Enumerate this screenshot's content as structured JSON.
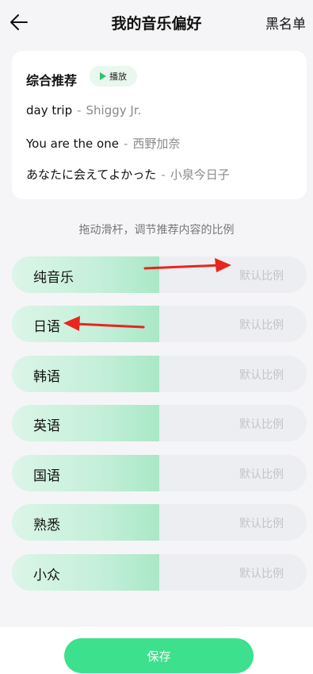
{
  "header": {
    "title": "我的音乐偏好",
    "blacklist_label": "黑名单",
    "back_icon": "arrow-left-icon"
  },
  "recommend": {
    "title": "综合推荐",
    "play_label": "播放",
    "songs": [
      {
        "title": "day trip",
        "separator": "-",
        "artist": "Shiggy Jr."
      },
      {
        "title": "You are the one",
        "separator": "-",
        "artist": "西野加奈"
      },
      {
        "title": "あなたに会えてよかった",
        "separator": "-",
        "artist": "小泉今日子"
      }
    ]
  },
  "hint": "拖动滑杆，调节推荐内容的比例",
  "sliders": [
    {
      "label": "纯音乐",
      "value_text": "默认比例",
      "level": 0.5
    },
    {
      "label": "日语",
      "value_text": "默认比例",
      "level": 0.5
    },
    {
      "label": "韩语",
      "value_text": "默认比例",
      "level": 0.5
    },
    {
      "label": "英语",
      "value_text": "默认比例",
      "level": 0.5
    },
    {
      "label": "国语",
      "value_text": "默认比例",
      "level": 0.5
    },
    {
      "label": "熟悉",
      "value_text": "默认比例",
      "level": 0.5
    },
    {
      "label": "小众",
      "value_text": "默认比例",
      "level": 0.5
    }
  ],
  "save_label": "保存",
  "colors": {
    "accent": "#3de08c",
    "fill_start": "#dcf5e8",
    "fill_end": "#a9e8c6",
    "annotation": "#e8251f"
  }
}
